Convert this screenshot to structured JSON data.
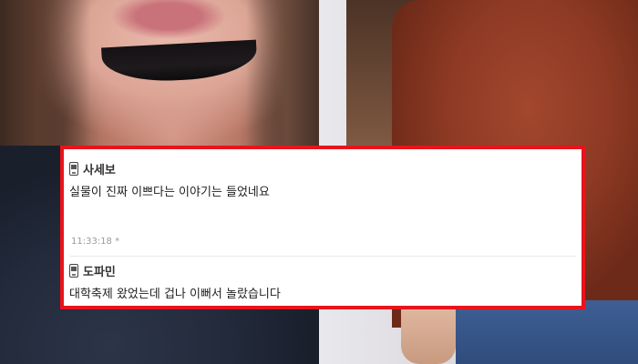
{
  "comments": [
    {
      "author": "사세보",
      "author_icon": "mobile-phone-icon",
      "text": "실물이 진짜 이쁘다는 이야기는 들었네요",
      "timestamp": "11:33:18 *"
    },
    {
      "author": "도파민",
      "author_icon": "mobile-phone-icon",
      "text": "대학축제 왔었는데 겁나 이뻐서 놀랐습니다"
    }
  ],
  "colors": {
    "highlight_border": "#e8141b",
    "comment_background": "#ffffff",
    "author_text": "#333333",
    "body_text": "#222222",
    "timestamp_text": "#9a9a9a"
  }
}
